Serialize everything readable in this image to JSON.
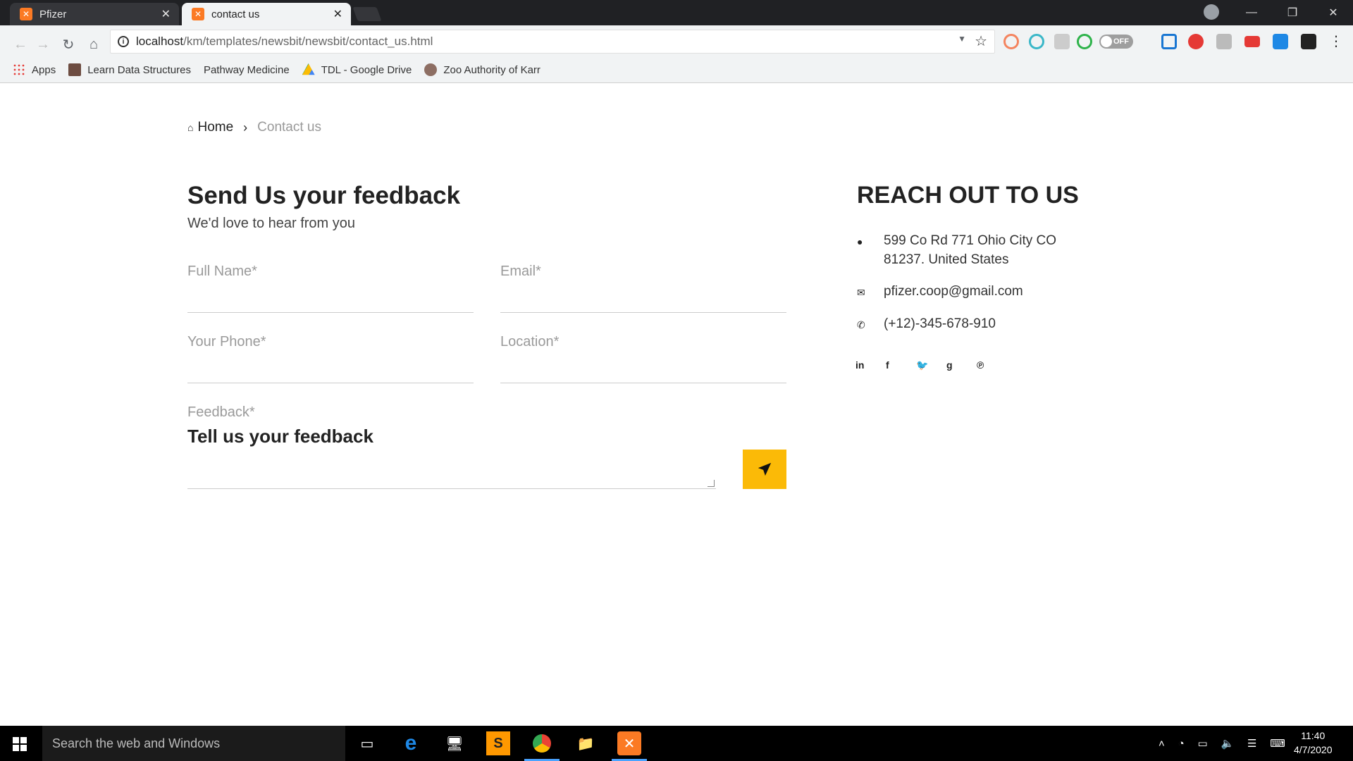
{
  "browser": {
    "tabs": [
      {
        "label": "Pfizer",
        "close": "✕"
      },
      {
        "label": "contact us",
        "close": "✕"
      }
    ],
    "window_controls": {
      "minimize": "—",
      "maximize": "❐",
      "close": "✕"
    },
    "url_host": "localhost",
    "url_path": "/km/templates/newsbit/newsbit/contact_us.html",
    "toggle_label": "OFF",
    "bookmarks": [
      {
        "label": "Apps",
        "icon": "apps-grid-icon",
        "color": "#e53935"
      },
      {
        "label": "Learn Data Structures",
        "icon": "cc-icon",
        "color": "#6d4c41"
      },
      {
        "label": "Pathway Medicine",
        "icon": "",
        "color": ""
      },
      {
        "label": "TDL - Google Drive",
        "icon": "google-drive-icon",
        "color": "#fbbc04"
      },
      {
        "label": "Zoo Authority of Karr",
        "icon": "emblem-icon",
        "color": "#8d6e63"
      }
    ]
  },
  "page": {
    "breadcrumb": {
      "home": "Home",
      "current": "Contact us"
    },
    "form": {
      "title": "Send Us your feedback",
      "subtitle": "We'd love to hear from you",
      "full_name_label": "Full Name*",
      "email_label": "Email*",
      "phone_label": "Your Phone*",
      "location_label": "Location*",
      "feedback_label": "Feedback*",
      "feedback_text": "Tell us your feedback"
    },
    "reach": {
      "title": "REACH OUT TO US",
      "address_line1": "599 Co Rd 771 Ohio City CO",
      "address_line2": "81237. United States",
      "email": "pfizer.coop@gmail.com",
      "phone": "(+12)-345-678-910",
      "socials": [
        "linkedin-icon",
        "facebook-icon",
        "twitter-icon",
        "google-plus-icon",
        "pinterest-icon"
      ]
    },
    "accent_color": "#fbba07"
  },
  "taskbar": {
    "search_placeholder": "Search the web and Windows",
    "time": "11:40",
    "date": "4/7/2020"
  }
}
